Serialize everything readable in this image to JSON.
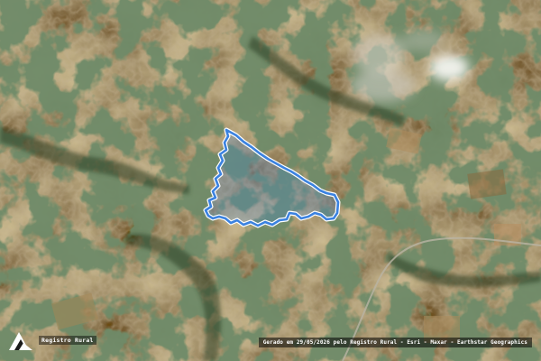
{
  "map": {
    "basemap": "satellite-imagery",
    "boundary_color": "#3b82e0",
    "boundary_fill": "rgba(59,130,224,0.25)",
    "road_color": "#b9b4a4"
  },
  "brand": {
    "name": "Registro Rural",
    "icon": "registro-rural-logo-icon"
  },
  "attribution": {
    "text": "Gerado em 29/05/2026 pelo Registro Rural - Esri - Maxar - Earthstar Geographics"
  }
}
